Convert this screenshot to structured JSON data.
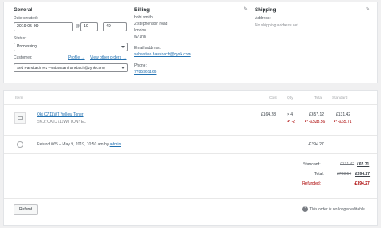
{
  "general": {
    "title": "General",
    "date_label": "Date created:",
    "date_value": "2019-05-09",
    "hour_value": "10",
    "minute_value": "49",
    "at_sep": "@",
    "colon_sep": ":",
    "status_label": "Status:",
    "status_value": "Processing",
    "customer_label": "Customer:",
    "profile_link": "Profile →",
    "other_orders_link": "View other orders →",
    "customer_value": "Seb Hansbach (#2 – sebastian.hansbach@zynk.com)"
  },
  "billing": {
    "title": "Billing",
    "address_lines": [
      "bobi smith",
      "2 stephenson road",
      "london",
      "w71nn"
    ],
    "email_label": "Email address:",
    "email_value": "sebastian.hansbach@zynk.com",
    "phone_label": "Phone:",
    "phone_value": "7785961166"
  },
  "shipping": {
    "title": "Shipping",
    "address_label": "Address:",
    "address_value": "No shipping address set."
  },
  "items": {
    "headers": {
      "item": "Item",
      "cost": "Cost",
      "qty": "Qty",
      "total": "Total",
      "standard": "Standard"
    },
    "product": {
      "name": "Oki C711WT Yellow Toner",
      "sku_label": "SKU:",
      "sku_value": "OKIC711WTTONYEL",
      "cost": "£164.28",
      "qty": "× 4",
      "qty_refund": "↶ -2",
      "total": "£657.12",
      "total_refund": "↶ -£328.56",
      "standard": "£131.42",
      "standard_refund": "↶ -£65.71"
    },
    "refund_row": {
      "text": "Refund #65 – May 9, 2019, 10:50 am by",
      "by_user": "admin",
      "amount": "-£394.27"
    }
  },
  "totals": {
    "standard_label": "Standard:",
    "standard_old": "£131.42",
    "standard_new": "£65.71",
    "total_label": "Total:",
    "total_old": "£788.54",
    "total_new": "£394.27",
    "refunded_label": "Refunded:",
    "refunded_value": "-£394.27"
  },
  "footer": {
    "refund_button": "Refund",
    "note_icon": "help-icon",
    "note": "This order is no longer editable."
  }
}
